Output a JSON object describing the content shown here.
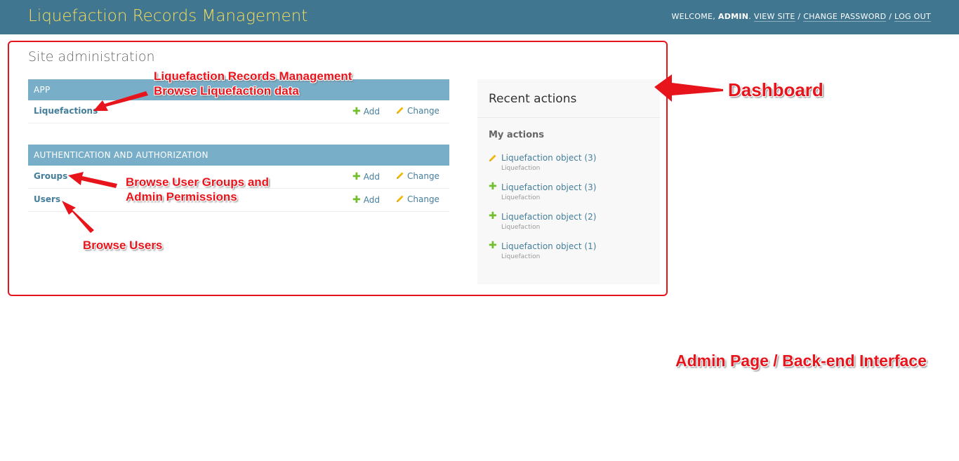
{
  "header": {
    "site_name": "Liquefaction Records Management",
    "welcome_prefix": "WELCOME,",
    "username": "ADMIN",
    "welcome_suffix": ".",
    "view_site": "VIEW SITE",
    "change_password": "CHANGE PASSWORD",
    "log_out": "LOG OUT",
    "separator": "/"
  },
  "main": {
    "title": "Site administration",
    "modules": [
      {
        "caption": "APP",
        "rows": [
          {
            "name": "Liquefactions",
            "add": "Add",
            "change": "Change"
          }
        ]
      },
      {
        "caption": "AUTHENTICATION AND AUTHORIZATION",
        "rows": [
          {
            "name": "Groups",
            "add": "Add",
            "change": "Change"
          },
          {
            "name": "Users",
            "add": "Add",
            "change": "Change"
          }
        ]
      }
    ]
  },
  "recent_actions": {
    "title": "Recent actions",
    "subtitle": "My actions",
    "items": [
      {
        "icon": "pencil-icon",
        "label": "Liquefaction object (3)",
        "type": "Liquefaction"
      },
      {
        "icon": "plus-icon",
        "label": "Liquefaction object (3)",
        "type": "Liquefaction"
      },
      {
        "icon": "plus-icon",
        "label": "Liquefaction object (2)",
        "type": "Liquefaction"
      },
      {
        "icon": "plus-icon",
        "label": "Liquefaction object (1)",
        "type": "Liquefaction"
      }
    ]
  },
  "annotations": {
    "liquefaction_line1": "Liquefaction Records Management",
    "liquefaction_line2": "Browse Liquefaction data",
    "groups_line1": "Browse User Groups and",
    "groups_line2": "Admin Permissions",
    "users": "Browse Users",
    "dashboard": "Dashboard",
    "admin_page": "Admin Page / Back-end Interface"
  },
  "colors": {
    "header_bg": "#417690",
    "brand_text": "#f5dd5d",
    "module_caption_bg": "#79aec8",
    "link": "#447e9b",
    "add_icon": "#70bf2b",
    "change_icon": "#efb80b",
    "annotation": "#e8141c"
  }
}
